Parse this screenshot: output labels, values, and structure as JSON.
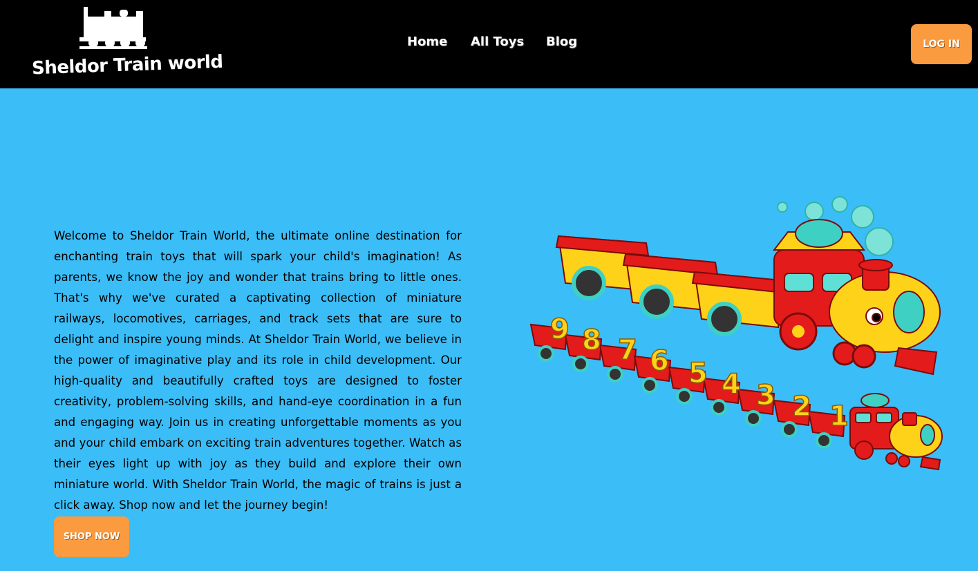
{
  "brand": {
    "name": "Sheldor Train world",
    "logo_icon": "locomotive-icon"
  },
  "nav": {
    "items": [
      {
        "label": "Home"
      },
      {
        "label": "All Toys"
      },
      {
        "label": "Blog"
      }
    ],
    "login_label": "LOG IN"
  },
  "hero": {
    "description": "Welcome to Sheldor Train World, the ultimate online destination for enchanting train toys that will spark your child's imagination! As parents, we know the joy and wonder that trains bring to little ones. That's why we've curated a captivating collection of miniature railways, locomotives, carriages, and track sets that are sure to delight and inspire young minds. At Sheldor Train World, we believe in the power of imaginative play and its role in child development. Our high-quality and beautifully crafted toys are designed to foster creativity, problem-solving skills, and hand-eye coordination in a fun and engaging way. Join us in creating unforgettable moments as you and your child embark on exciting train adventures together. Watch as their eyes light up with joy as they build and explore their own miniature world. With Sheldor Train World, the magic of trains is just a click away. Shop now and let the journey begin!",
    "cta_label": "SHOP NOW",
    "illustration_numbers": [
      "9",
      "8",
      "7",
      "6",
      "5",
      "4",
      "3",
      "2",
      "1"
    ]
  },
  "colors": {
    "navbar": "#000000",
    "page_background": "#3bbdf7",
    "button": "#fb9b3f",
    "train_red": "#e31b1b",
    "train_yellow": "#ffd21a",
    "train_teal": "#3fd0c4"
  }
}
